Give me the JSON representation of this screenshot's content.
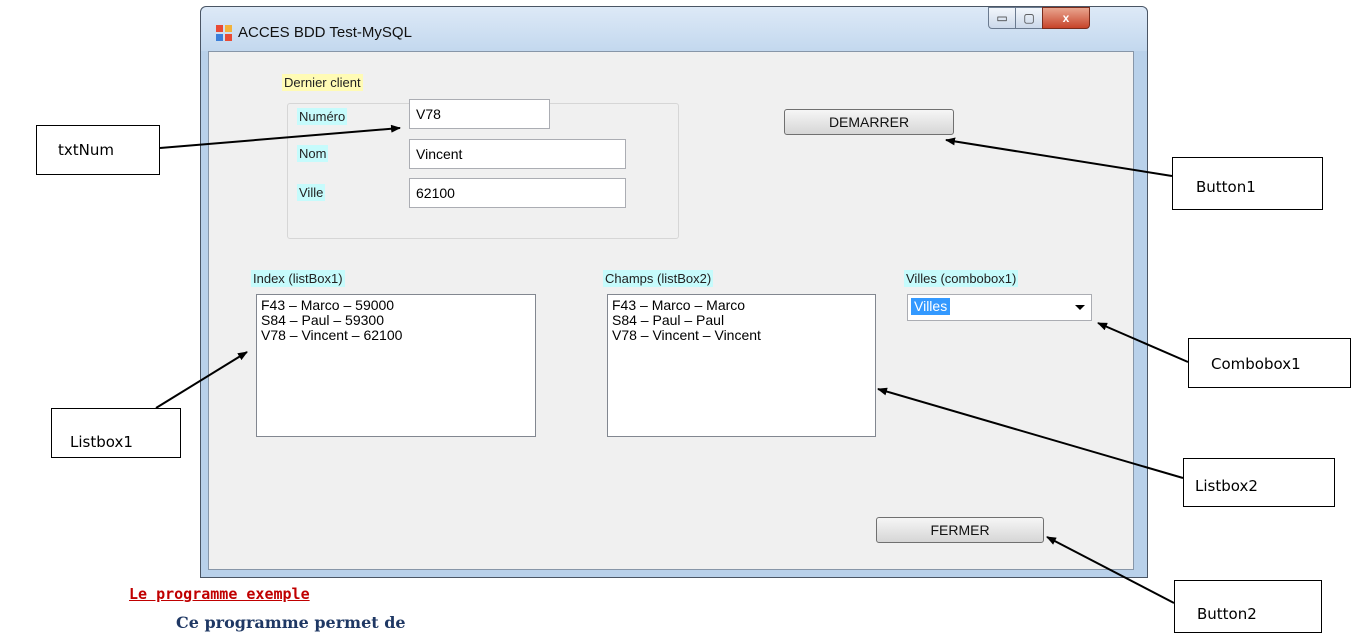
{
  "window": {
    "title": "ACCES BDD Test-MySQL",
    "controls": {
      "minimize": "▭",
      "maximize": "▢",
      "close": "x"
    }
  },
  "form": {
    "group_title": "Dernier client",
    "numero_label": "Numéro",
    "numero_value": "V78",
    "nom_label": "Nom",
    "nom_value": "Vincent",
    "ville_label": "Ville",
    "ville_value": "62100",
    "start_button": "DEMARRER",
    "close_button": "FERMER",
    "listbox1_label": "Index (listBox1)",
    "listbox1_items": [
      "F43 – Marco – 59000",
      "S84 – Paul – 59300",
      "V78 – Vincent – 62100"
    ],
    "listbox2_label": "Champs  (listBox2)",
    "listbox2_items": [
      "F43 – Marco – Marco",
      "S84 – Paul – Paul",
      "V78 – Vincent – Vincent"
    ],
    "combobox_label": "Villes (combobox1)",
    "combobox_value": "Villes"
  },
  "callouts": {
    "txtnum": "txtNum",
    "button1": "Button1",
    "combobox1": "Combobox1",
    "listbox1": "Listbox1",
    "listbox2": "Listbox2",
    "button2": "Button2"
  },
  "document": {
    "heading": "Le programme exemple",
    "line": "Ce programme permet de"
  },
  "colors": {
    "label_yellow": "#fffbb5",
    "label_cyan": "#c6fbfc",
    "heading_red": "#c00000",
    "selection_blue": "#3399ff"
  }
}
